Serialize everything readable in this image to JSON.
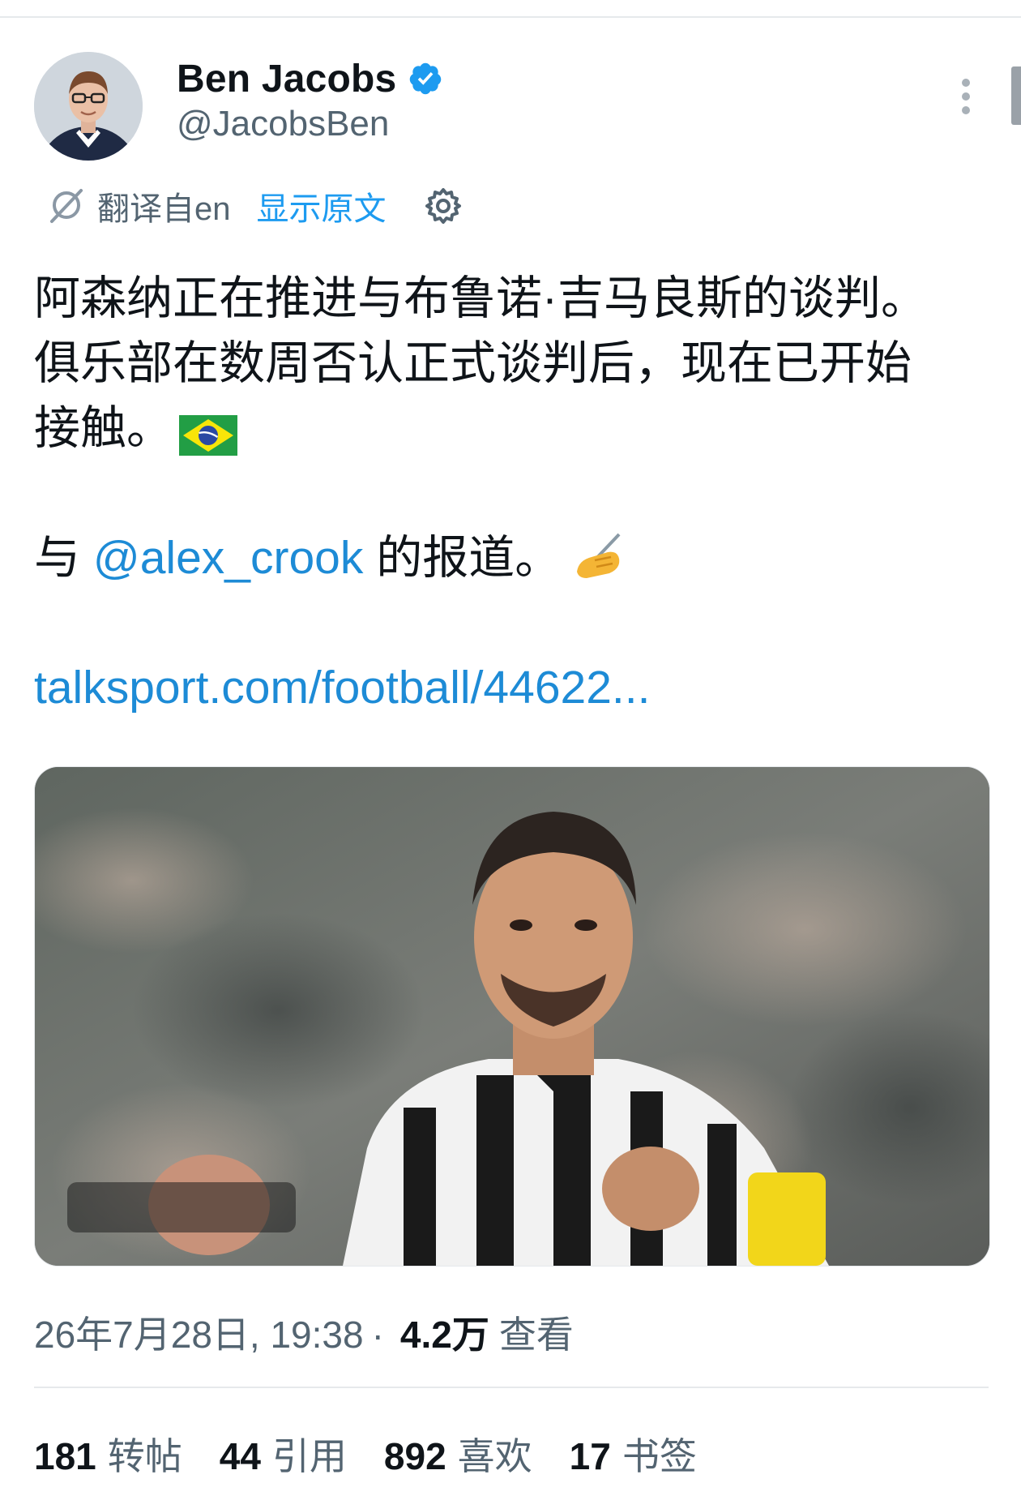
{
  "author": {
    "display_name": "Ben Jacobs",
    "handle": "@JacobsBen",
    "verified": true
  },
  "translation": {
    "label": "翻译自en",
    "show_original": "显示原文"
  },
  "tweet": {
    "lines": [
      "阿森纳正在推进与布鲁诺·吉马良斯的谈判。",
      "俱乐部在数周否认正式谈判后，现在已开始",
      "接触。"
    ],
    "mention_prefix": "与 ",
    "mention": "@alex_crook",
    "mention_suffix": " 的报道。",
    "link": "talksport.com/football/44622..."
  },
  "meta": {
    "timestamp": "26年7月28日, 19:38",
    "separator": "·",
    "views_count": "4.2万",
    "views_label": "查看"
  },
  "stats": [
    {
      "count": "181",
      "label": "转帖"
    },
    {
      "count": "44",
      "label": "引用"
    },
    {
      "count": "892",
      "label": "喜欢"
    },
    {
      "count": "17",
      "label": "书签"
    }
  ],
  "colors": {
    "accent": "#1d9bf0",
    "link": "#1d8bd6",
    "secondary_text": "#536471",
    "primary_text": "#0f1419"
  },
  "icons": {
    "verified": "verified-badge-icon",
    "more": "more-vertical-icon",
    "translate": "translate-icon",
    "settings": "gear-icon",
    "flag": "brazil-flag-icon",
    "emoji": "writing-hand-icon"
  }
}
